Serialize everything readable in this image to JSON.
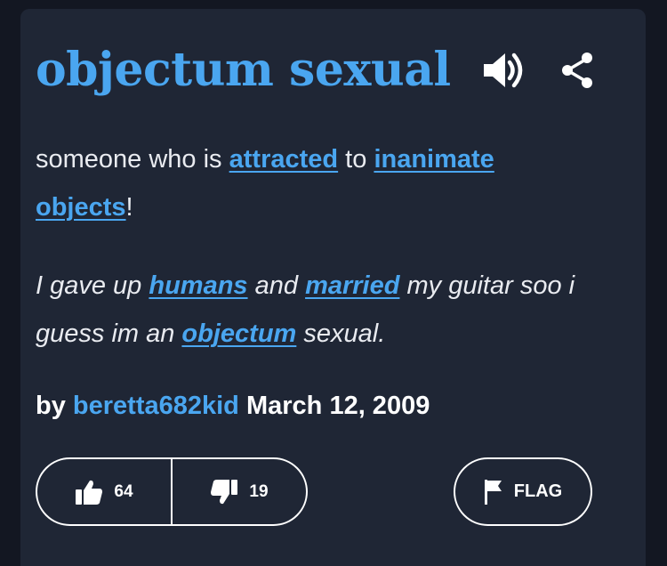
{
  "entry": {
    "word": "objectum sexual",
    "definition": {
      "t1": "someone who is ",
      "link1": "attracted",
      "t2": " to ",
      "link2": "inanimate objects",
      "t3": "!"
    },
    "example": {
      "t1": "I gave up ",
      "link1": "humans",
      "t2": " and ",
      "link2": "married",
      "t3": " my guitar soo i guess im an ",
      "link3": "objectum",
      "t4": " sexual."
    },
    "contributor": {
      "prefix": "by",
      "author": "beretta682kid",
      "date": "March 12, 2009"
    },
    "votes": {
      "up": "64",
      "down": "19"
    },
    "flag_label": "FLAG"
  },
  "icons": {
    "audio": "speaker-icon",
    "share": "share-icon",
    "thumbs_up": "thumbs-up-icon",
    "thumbs_down": "thumbs-down-icon",
    "flag": "flag-icon"
  },
  "colors": {
    "background": "#131722",
    "card": "#1f2635",
    "accent": "#4aa6f0",
    "text": "#e9ebf0",
    "white": "#ffffff"
  }
}
